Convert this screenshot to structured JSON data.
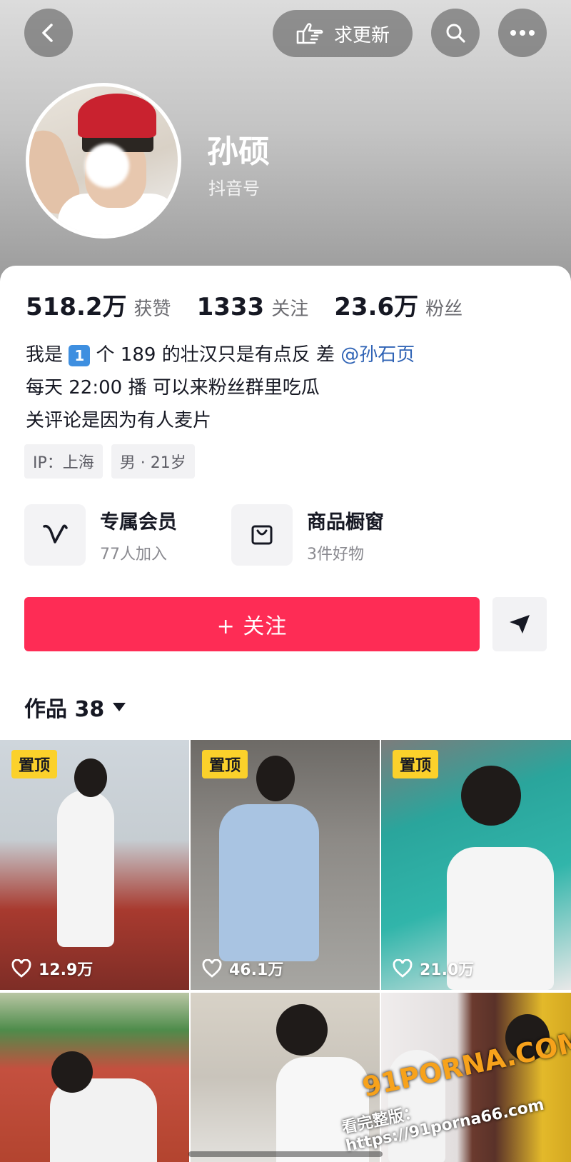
{
  "header": {
    "request_update_label": "求更新",
    "nickname": "孙硕",
    "id_label": "抖音号"
  },
  "stats": [
    {
      "value": "518.2万",
      "label": "获赞"
    },
    {
      "value": "1333",
      "label": "关注"
    },
    {
      "value": "23.6万",
      "label": "粉丝"
    }
  ],
  "bio": {
    "line1_prefix": "我是",
    "line1_badge": "1",
    "line1_text": "个 189 的壮汉只是有点反 差",
    "line1_mention": "@孙石页",
    "line2": "每天 22:00 播  可以来粉丝群里吃瓜",
    "line3": "关评论是因为有人麦片"
  },
  "tags": [
    "IP：上海",
    "男 · 21岁"
  ],
  "features": [
    {
      "title": "专属会员",
      "subtitle": "77人加入",
      "icon": "v-member-icon"
    },
    {
      "title": "商品橱窗",
      "subtitle": "3件好物",
      "icon": "shopping-bag-icon"
    }
  ],
  "follow_label": "+ 关注",
  "works_tab": {
    "label": "作品 38"
  },
  "videos": [
    {
      "pinned": true,
      "pin_label": "置顶",
      "likes": "12.9万"
    },
    {
      "pinned": true,
      "pin_label": "置顶",
      "likes": "46.1万"
    },
    {
      "pinned": true,
      "pin_label": "置顶",
      "likes": "21.0万"
    },
    {
      "pinned": false,
      "likes": ""
    },
    {
      "pinned": false,
      "likes": ""
    },
    {
      "pinned": false,
      "likes": ""
    }
  ],
  "watermark": {
    "brand": "91PORNA.COM",
    "url": "看完整版：https://91porna66.com"
  },
  "colors": {
    "follow": "#fe2c55",
    "pin": "#fbd12b",
    "mention": "#2f63b5"
  }
}
